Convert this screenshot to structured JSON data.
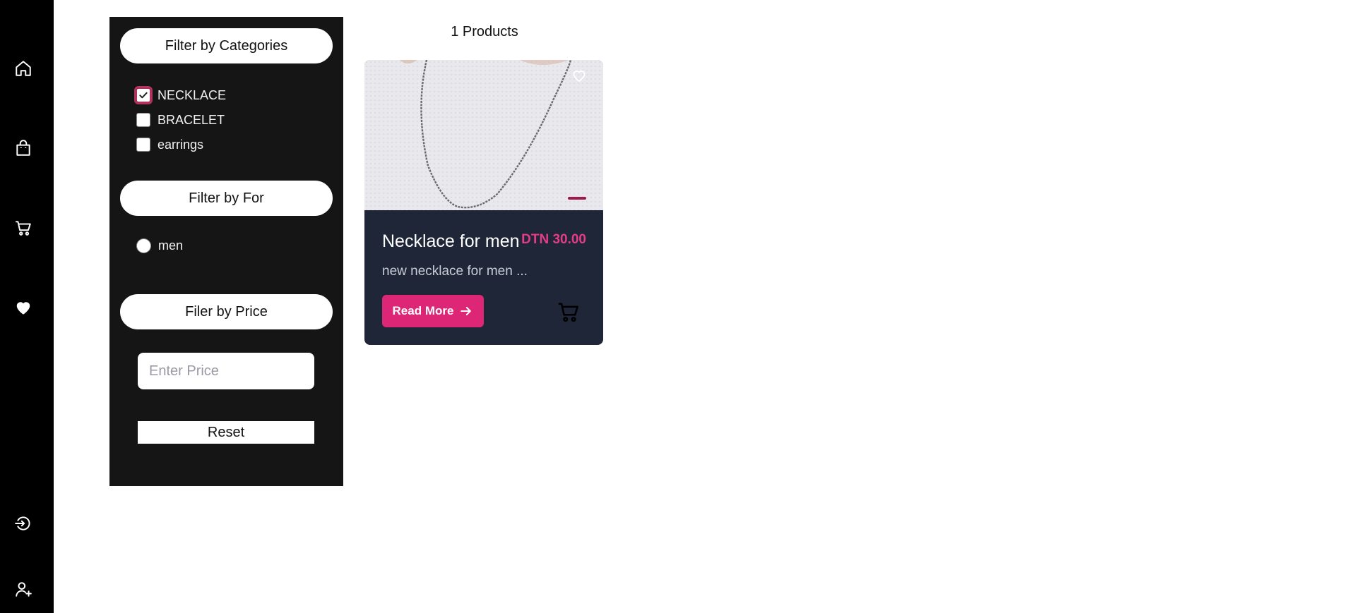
{
  "sidebar": {
    "items": [
      {
        "icon": "home-icon"
      },
      {
        "icon": "shopping-bag-icon"
      },
      {
        "icon": "cart-icon"
      },
      {
        "icon": "heart-icon"
      },
      {
        "icon": "login-icon"
      },
      {
        "icon": "user-add-icon"
      }
    ]
  },
  "filters": {
    "categories_label": "Filter by Categories",
    "categories": [
      {
        "label": "NECKLACE",
        "checked": true
      },
      {
        "label": "BRACELET",
        "checked": false
      },
      {
        "label": "earrings",
        "checked": false
      }
    ],
    "for_label": "Filter by For",
    "for_options": [
      {
        "label": "men",
        "selected": false
      }
    ],
    "price_label": "Filer by Price",
    "price_placeholder": "Enter Price",
    "price_value": "",
    "reset_label": "Reset"
  },
  "products": {
    "count_text": "1 Products",
    "items": [
      {
        "title": "Necklace for men",
        "price": "DTN 30.00",
        "description": "new necklace for men ...",
        "read_more_label": "Read More"
      }
    ]
  },
  "colors": {
    "accent": "#de2676",
    "price": "#e43d85",
    "card_bg": "#1f2638",
    "panel_bg": "#151515",
    "sidebar_bg": "#000000"
  }
}
